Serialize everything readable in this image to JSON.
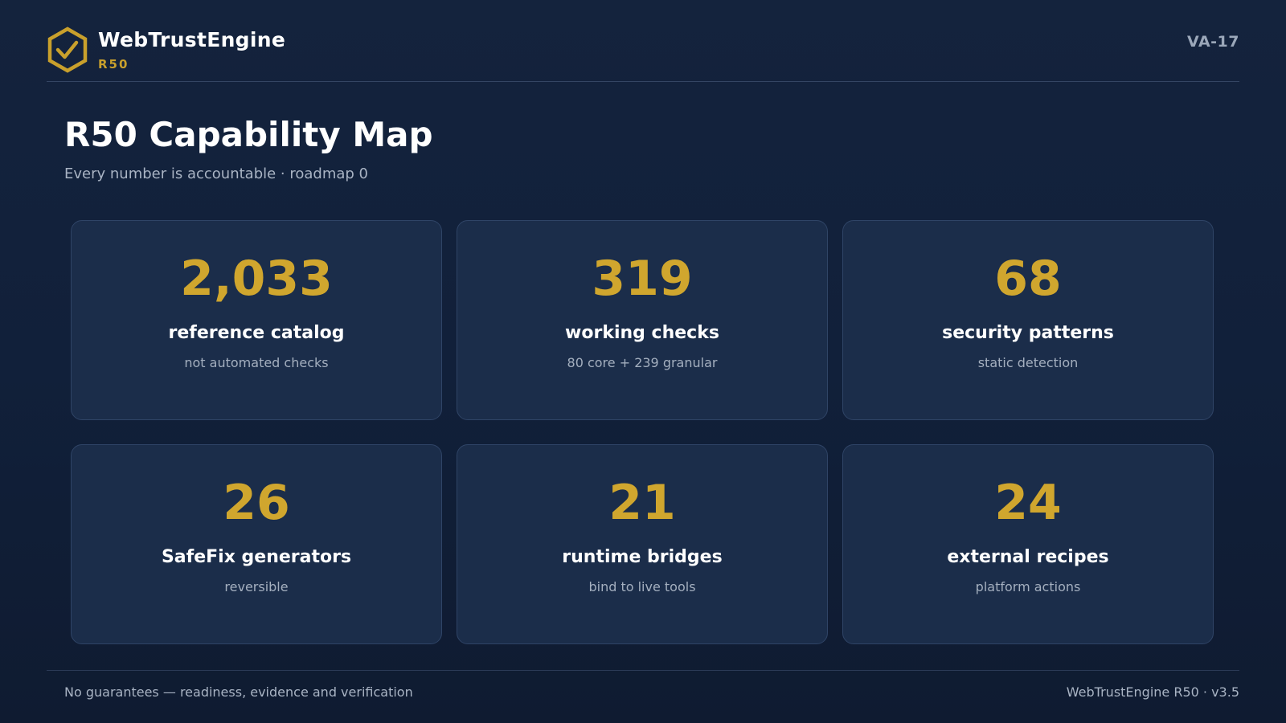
{
  "header": {
    "brand_name": "WebTrustEngine",
    "brand_sub": "R50",
    "doc_code": "VA-17",
    "logo_icon": "hexagon-check-icon",
    "accent_color": "#c9a02c"
  },
  "page": {
    "title": "R50 Capability Map",
    "subtitle": "Every number is accountable · roadmap 0"
  },
  "cards": [
    {
      "value": "2,033",
      "label": "reference catalog",
      "desc": "not automated checks"
    },
    {
      "value": "319",
      "label": "working checks",
      "desc": "80 core + 239 granular"
    },
    {
      "value": "68",
      "label": "security patterns",
      "desc": "static detection"
    },
    {
      "value": "26",
      "label": "SafeFix generators",
      "desc": "reversible"
    },
    {
      "value": "21",
      "label": "runtime bridges",
      "desc": "bind to live tools"
    },
    {
      "value": "24",
      "label": "external recipes",
      "desc": "platform actions"
    }
  ],
  "footer": {
    "left": "No guarantees — readiness, evidence and verification",
    "right": "WebTrustEngine R50 · v3.5"
  }
}
